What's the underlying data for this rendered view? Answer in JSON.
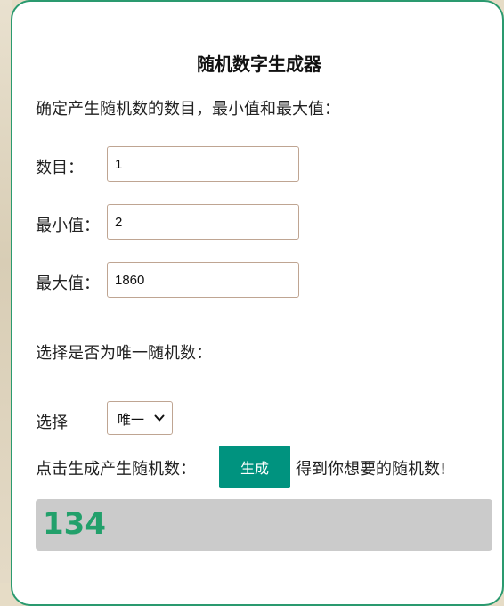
{
  "title": "随机数字生成器",
  "intro": "确定产生随机数的数目，最小值和最大值：",
  "fields": {
    "count": {
      "label": "数目：",
      "value": "1"
    },
    "min": {
      "label": "最小值：",
      "value": "2"
    },
    "max": {
      "label": "最大值：",
      "value": "1860"
    }
  },
  "unique_prompt": "选择是否为唯一随机数：",
  "select": {
    "label": "选择",
    "selected": "唯一"
  },
  "generate": {
    "prompt": "点击生成产生随机数：",
    "button_label": "生成",
    "after_text": "得到你想要的随机数!"
  },
  "result": "134",
  "colors": {
    "accent": "#00937f",
    "border": "#2a9a6f",
    "result_text": "#22a06b",
    "result_bg": "#cbcbcb"
  }
}
